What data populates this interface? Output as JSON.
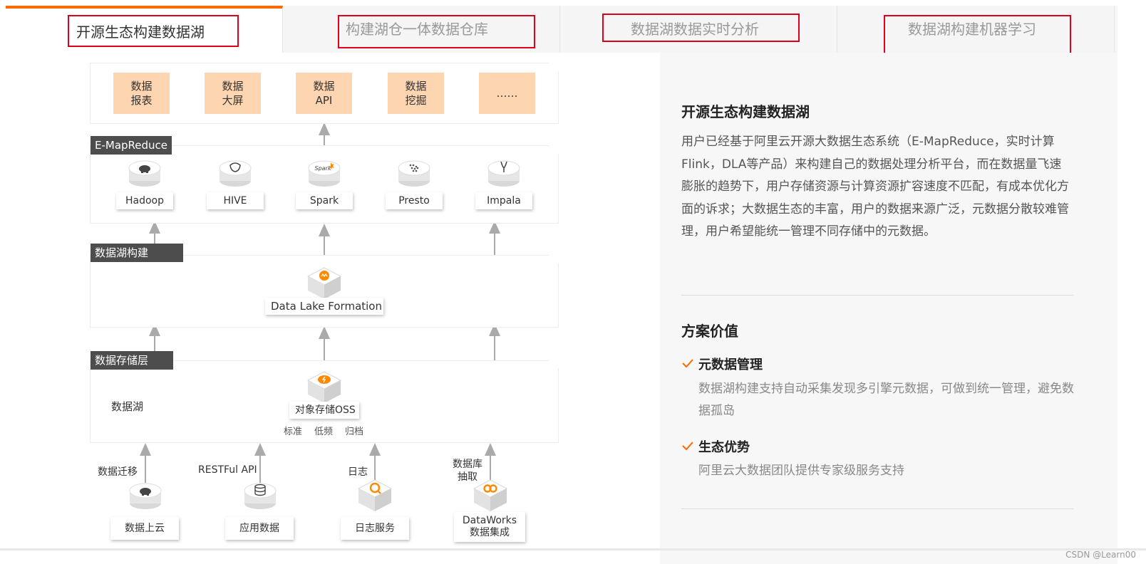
{
  "tabs": [
    {
      "label": "开源生态构建数据湖",
      "active": true
    },
    {
      "label": "构建湖仓一体数据仓库",
      "active": false
    },
    {
      "label": "数据湖数据实时分析",
      "active": false
    },
    {
      "label": "数据湖构建机器学习",
      "active": false
    }
  ],
  "colors": {
    "accent": "#ff6a00",
    "highlight_box": "#e0001b",
    "app_box": "#fdd5b1",
    "tag_bg": "#4d4d4d"
  },
  "diagram": {
    "apps": [
      {
        "label": "数据\n报表"
      },
      {
        "label": "数据\n大屏"
      },
      {
        "label": "数据\nAPI"
      },
      {
        "label": "数据\n挖掘"
      },
      {
        "label": "……"
      }
    ],
    "compute": {
      "tag": "E-MapReduce",
      "engines": [
        {
          "label": "Hadoop",
          "icon": "hadoop-elephant-icon"
        },
        {
          "label": "HIVE",
          "icon": "hive-bee-icon"
        },
        {
          "label": "Spark",
          "icon": "spark-logo-icon",
          "icon_text": "Spark"
        },
        {
          "label": "Presto",
          "icon": "presto-dots-icon"
        },
        {
          "label": "Impala",
          "icon": "impala-antelope-icon"
        }
      ]
    },
    "build": {
      "tag": "数据湖构建",
      "product": "Data Lake Formation",
      "icon": "data-lake-formation-icon"
    },
    "storage": {
      "tag": "数据存储层",
      "lake_label": "数据湖",
      "product": "对象存储OSS",
      "icon": "oss-cloud-icon",
      "tiers": [
        "标准",
        "低频",
        "归档"
      ]
    },
    "sources": [
      {
        "arrow_label": "数据迁移",
        "label": "数据上云",
        "icon": "hadoop-disc-icon"
      },
      {
        "arrow_label": "RESTFul API",
        "label": "应用数据",
        "icon": "database-disc-icon"
      },
      {
        "arrow_label": "日志",
        "label": "日志服务",
        "icon": "log-service-icon"
      },
      {
        "arrow_label": "数据库\n抽取",
        "label": "DataWorks\n数据集成",
        "icon": "dataworks-icon"
      }
    ]
  },
  "panel": {
    "title": "开源生态构建数据湖",
    "description": "用户已经基于阿里云开源大数据生态系统（E-MapReduce，实时计算Flink，DLA等产品）来构建自己的数据处理分析平台，而在数据量飞速膨胀的趋势下，用户存储资源与计算资源扩容速度不匹配，有成本优化方面的诉求；大数据生态的丰富，用户的数据来源广泛，元数据分散较难管理，用户希望能统一管理不同存储中的元数据。",
    "value_title": "方案价值",
    "values": [
      {
        "title": "元数据管理",
        "desc": "数据湖构建支持自动采集发现多引擎元数据，可做到统一管理，避免数据孤岛"
      },
      {
        "title": "生态优势",
        "desc": "阿里云大数据团队提供专家级服务支持"
      }
    ]
  },
  "watermark": "CSDN @Learn00"
}
